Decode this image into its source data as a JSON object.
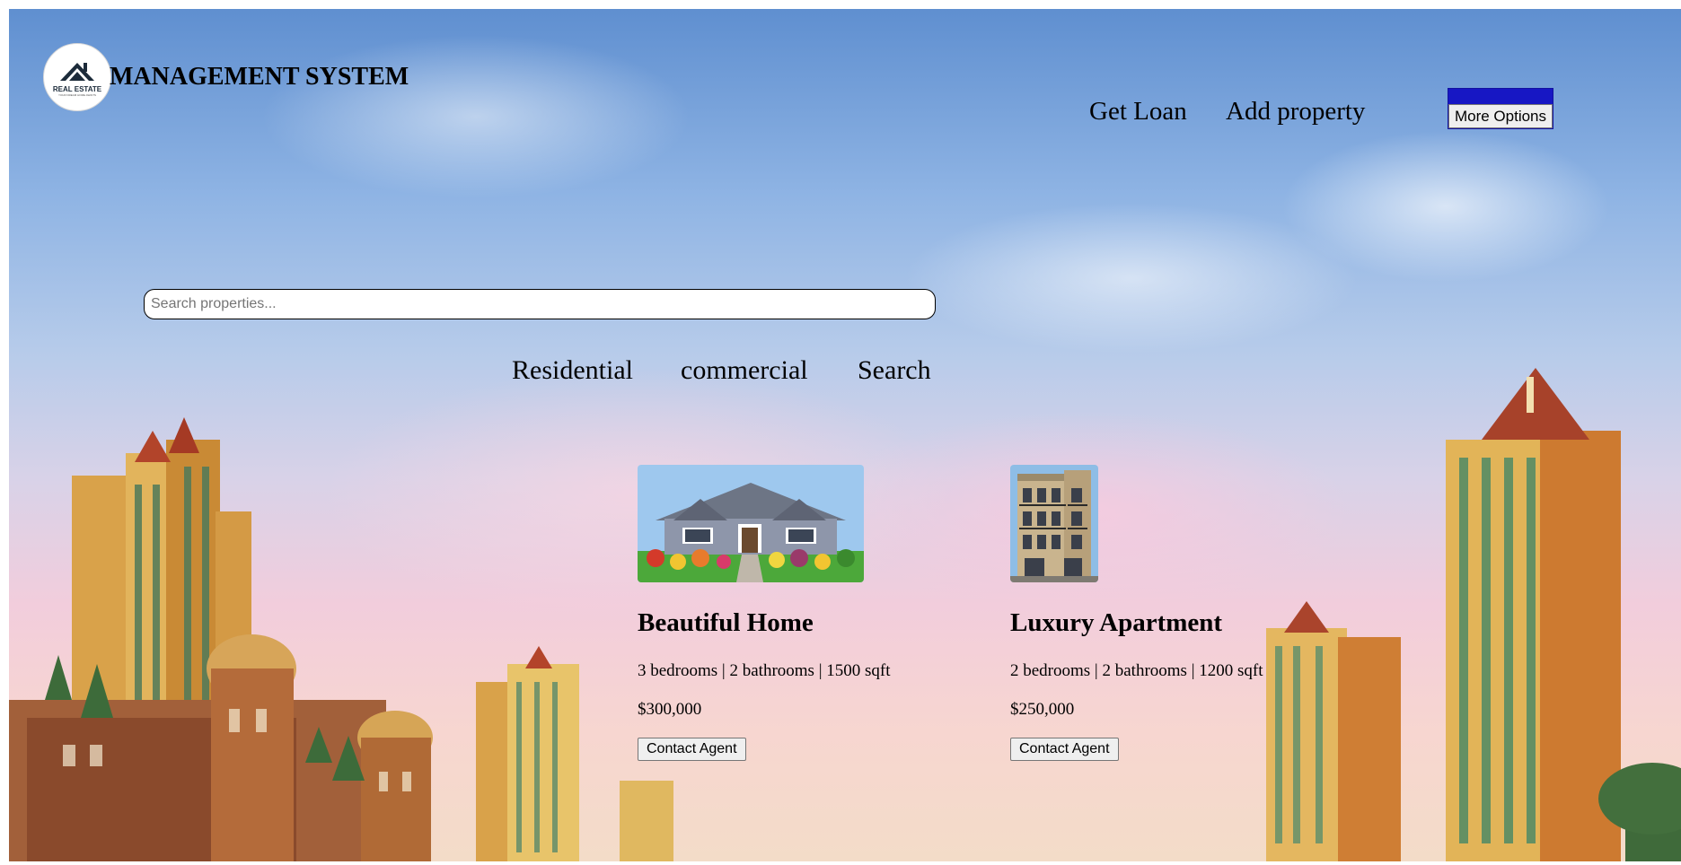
{
  "header": {
    "logo": {
      "name": "real-estate-logo",
      "title": "REAL ESTATE",
      "tagline": "YOUR DREAM HOME AWAITS"
    },
    "brand_title": "MANAGEMENT SYSTEM",
    "nav": [
      {
        "label": "Get Loan"
      },
      {
        "label": "Add property"
      }
    ],
    "more_options_label": "More Options",
    "more_options_color": "#1717c4"
  },
  "search": {
    "placeholder": "Search properties...",
    "value": "",
    "filters": [
      {
        "label": "Residential"
      },
      {
        "label": "commercial"
      },
      {
        "label": "Search"
      }
    ]
  },
  "listings": [
    {
      "title": "Beautiful Home",
      "specs": "3 bedrooms | 2 bathrooms | 1500 sqft",
      "price": "$300,000",
      "cta": "Contact Agent",
      "image": "house-photo"
    },
    {
      "title": "Luxury Apartment",
      "specs": "2 bedrooms | 2 bathrooms | 1200 sqft",
      "price": "$250,000",
      "cta": "Contact Agent",
      "image": "apartment-building-photo"
    }
  ],
  "background": {
    "image": "city-skyline-towers-sky"
  }
}
